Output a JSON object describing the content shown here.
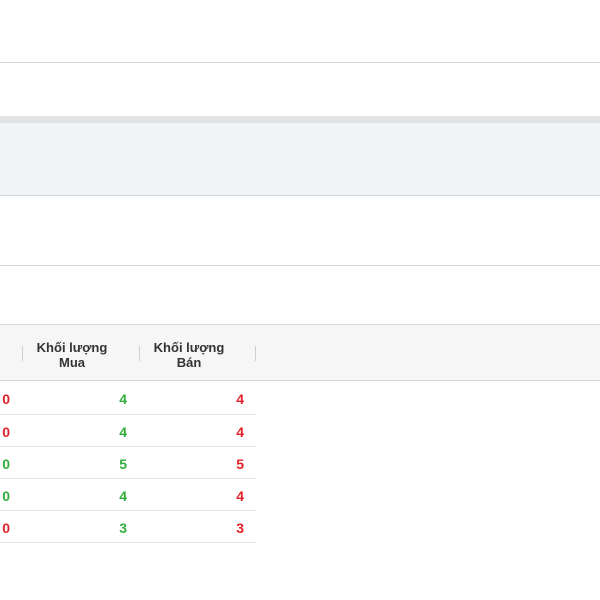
{
  "table": {
    "headers": {
      "buy_volume": [
        "Khối lượng",
        "Mua"
      ],
      "sell_volume": [
        "Khối lượng",
        "Bán"
      ]
    },
    "rows": [
      {
        "edge": "0",
        "edge_color": "red",
        "buy": "4",
        "sell": "4"
      },
      {
        "edge": "0",
        "edge_color": "red",
        "buy": "4",
        "sell": "4"
      },
      {
        "edge": "0",
        "edge_color": "green",
        "buy": "5",
        "sell": "5"
      },
      {
        "edge": "0",
        "edge_color": "green",
        "buy": "4",
        "sell": "4"
      },
      {
        "edge": "0",
        "edge_color": "red",
        "buy": "3",
        "sell": "3"
      }
    ]
  },
  "colors": {
    "buy": "#2fae3c",
    "sell": "#e0212a",
    "header_bg": "#f6f6f7",
    "band_bg": "#f3f4f6"
  }
}
